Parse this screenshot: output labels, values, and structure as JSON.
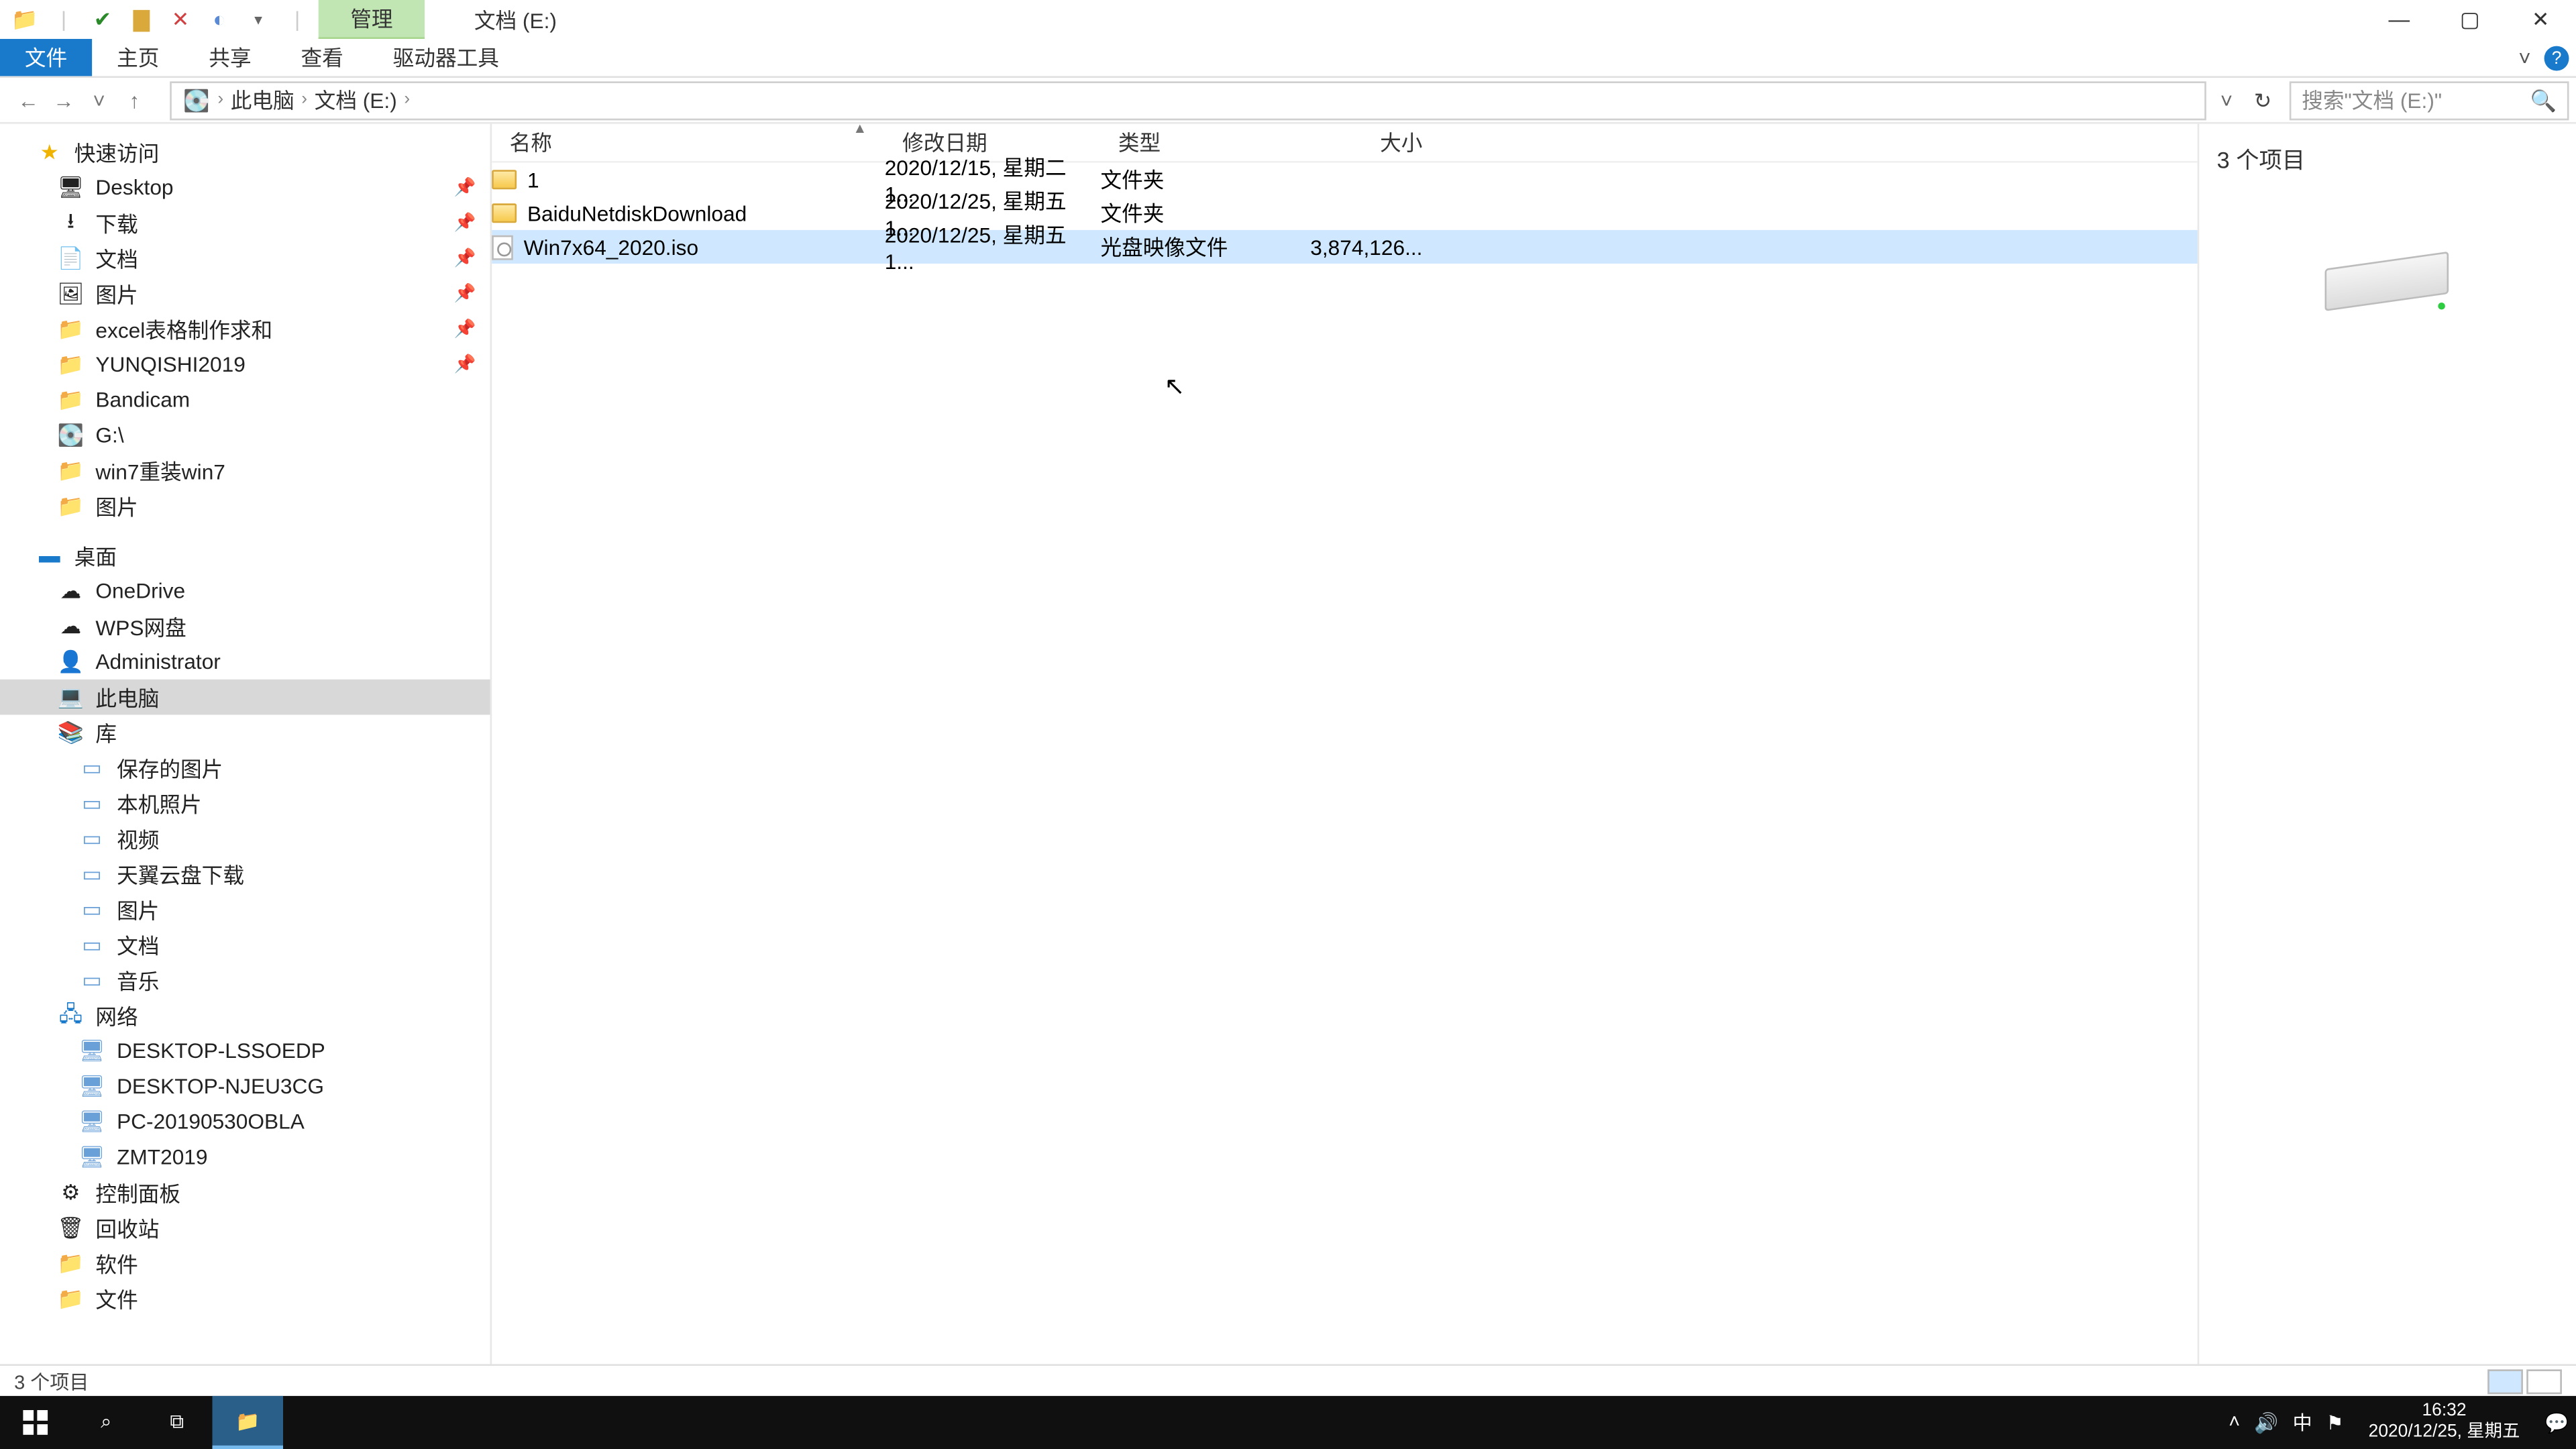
{
  "titlebar": {
    "manage_tab": "管理",
    "location_title": "文档 (E:)"
  },
  "window_controls": {
    "min": "—",
    "max": "▢",
    "close": "✕"
  },
  "ribbon": {
    "file": "文件",
    "home": "主页",
    "share": "共享",
    "view": "查看",
    "drive_tools": "驱动器工具"
  },
  "nav": {
    "back": "←",
    "fwd": "→",
    "recent": "˅",
    "up": "↑"
  },
  "address": {
    "root_icon": "›",
    "segments": [
      "此电脑",
      "文档 (E:)"
    ],
    "refresh": "↻",
    "dropdown": "˅"
  },
  "search": {
    "placeholder": "搜索\"文档 (E:)\""
  },
  "tree": {
    "quick_access": "快速访问",
    "qa_items": [
      {
        "label": "Desktop",
        "icon": "🖥"
      },
      {
        "label": "下载",
        "icon": "⭳"
      },
      {
        "label": "文档",
        "icon": "📄"
      },
      {
        "label": "图片",
        "icon": "🖼"
      },
      {
        "label": "excel表格制作求和",
        "icon": "📁"
      },
      {
        "label": "YUNQISHI2019",
        "icon": "📁"
      },
      {
        "label": "Bandicam",
        "icon": "📁"
      },
      {
        "label": "G:\\",
        "icon": "💽"
      },
      {
        "label": "win7重装win7",
        "icon": "📁"
      },
      {
        "label": "图片",
        "icon": "📁"
      }
    ],
    "desktop_group": "桌面",
    "desktop_items": [
      {
        "label": "OneDrive",
        "icon": "☁"
      },
      {
        "label": "WPS网盘",
        "icon": "☁"
      },
      {
        "label": "Administrator",
        "icon": "👤"
      },
      {
        "label": "此电脑",
        "icon": "💻",
        "selected": true
      },
      {
        "label": "库",
        "icon": "📚"
      }
    ],
    "lib_items": [
      {
        "label": "保存的图片"
      },
      {
        "label": "本机照片"
      },
      {
        "label": "视频"
      },
      {
        "label": "天翼云盘下载"
      },
      {
        "label": "图片"
      },
      {
        "label": "文档"
      },
      {
        "label": "音乐"
      }
    ],
    "network": "网络",
    "net_items": [
      {
        "label": "DESKTOP-LSSOEDP"
      },
      {
        "label": "DESKTOP-NJEU3CG"
      },
      {
        "label": "PC-20190530OBLA"
      },
      {
        "label": "ZMT2019"
      }
    ],
    "tail_items": [
      {
        "label": "控制面板",
        "icon": "⚙"
      },
      {
        "label": "回收站",
        "icon": "🗑"
      },
      {
        "label": "软件",
        "icon": "📁"
      },
      {
        "label": "文件",
        "icon": "📁"
      }
    ]
  },
  "columns": {
    "name": "名称",
    "date": "修改日期",
    "type": "类型",
    "size": "大小"
  },
  "files": [
    {
      "name": "1",
      "date": "2020/12/15, 星期二 1...",
      "type": "文件夹",
      "size": "",
      "kind": "folder"
    },
    {
      "name": "BaiduNetdiskDownload",
      "date": "2020/12/25, 星期五 1...",
      "type": "文件夹",
      "size": "",
      "kind": "folder"
    },
    {
      "name": "Win7x64_2020.iso",
      "date": "2020/12/25, 星期五 1...",
      "type": "光盘映像文件",
      "size": "3,874,126...",
      "kind": "iso",
      "selected": true
    }
  ],
  "preview": {
    "header": "3 个项目"
  },
  "status": {
    "text": "3 个项目"
  },
  "taskbar": {
    "time": "16:32",
    "date": "2020/12/25, 星期五",
    "ime": "中"
  }
}
